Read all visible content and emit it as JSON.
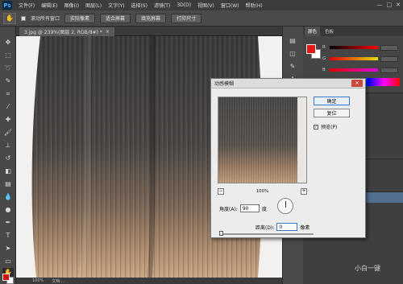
{
  "app": {
    "logo": "Ps"
  },
  "menu": [
    "文件(F)",
    "编辑(E)",
    "图像(I)",
    "图层(L)",
    "文字(Y)",
    "选择(S)",
    "滤镜(T)",
    "3D(D)",
    "视图(V)",
    "窗口(W)",
    "帮助(H)"
  ],
  "window_controls": {
    "minimize": "—",
    "restore": "□",
    "close": "✕"
  },
  "options_bar": {
    "scroll_all": "滚动所有窗口",
    "actual_pixels": "实际像素",
    "fit_screen": "适合屏幕",
    "fill_screen": "填充屏幕",
    "print_size": "打印尺寸"
  },
  "document": {
    "tab": "3.jpg @ 239%(图层 2, RGB/8#) *",
    "close": "×"
  },
  "status": {
    "zoom": "100%",
    "doc_info": "文档:..."
  },
  "panels": {
    "tab_color": "颜色",
    "tab_swatches": "色板",
    "channels": [
      "R",
      "G",
      "B"
    ]
  },
  "dialog": {
    "title": "动感模糊",
    "close": "✕",
    "ok": "确定",
    "reset": "复位",
    "preview_label": "预览(P)",
    "preview_checked": "✓",
    "zoom_level": "100%",
    "zoom_out": "−",
    "zoom_in": "+",
    "angle_label": "角度(A):",
    "angle_value": "90",
    "angle_unit": "度",
    "distance_label": "距离(D):",
    "distance_value": "0",
    "distance_unit": "像素"
  },
  "watermark": "小白一键"
}
